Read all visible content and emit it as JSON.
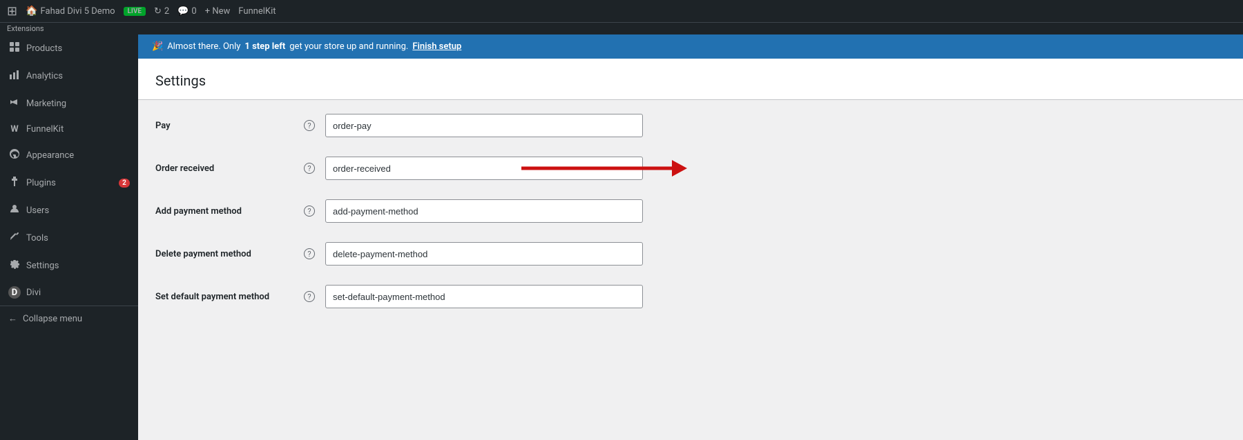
{
  "adminBar": {
    "wpIcon": "W",
    "siteName": "Fahad Divi 5 Demo",
    "liveBadge": "Live",
    "updates": "2",
    "comments": "0",
    "newLabel": "+ New",
    "funnelkit": "FunnelKit"
  },
  "extensionsBar": {
    "label": "Extensions"
  },
  "noticeBar": {
    "emoji": "🎉",
    "text1": "Almost there. Only",
    "boldText": "1 step left",
    "text2": "get your store up and running.",
    "linkText": "Finish setup"
  },
  "sidebar": {
    "items": [
      {
        "id": "products",
        "label": "Products",
        "icon": "📦",
        "badge": null
      },
      {
        "id": "analytics",
        "label": "Analytics",
        "icon": "📊",
        "badge": null
      },
      {
        "id": "marketing",
        "label": "Marketing",
        "icon": "📣",
        "badge": null
      },
      {
        "id": "funnelkit",
        "label": "FunnelKit",
        "icon": "W",
        "badge": null,
        "isSpecial": true
      },
      {
        "id": "appearance",
        "label": "Appearance",
        "icon": "🎨",
        "badge": null
      },
      {
        "id": "plugins",
        "label": "Plugins",
        "icon": "🔌",
        "badge": "2"
      },
      {
        "id": "users",
        "label": "Users",
        "icon": "👤",
        "badge": null
      },
      {
        "id": "tools",
        "label": "Tools",
        "icon": "🔧",
        "badge": null
      },
      {
        "id": "settings",
        "label": "Settings",
        "icon": "⚙",
        "badge": null
      },
      {
        "id": "divi",
        "label": "Divi",
        "icon": "D",
        "badge": null
      }
    ],
    "collapseLabel": "Collapse menu"
  },
  "settings": {
    "title": "Settings",
    "fields": [
      {
        "id": "pay",
        "label": "Pay",
        "value": "order-pay"
      },
      {
        "id": "order-received",
        "label": "Order received",
        "value": "order-received",
        "hasArrow": true
      },
      {
        "id": "add-payment-method",
        "label": "Add payment method",
        "value": "add-payment-method"
      },
      {
        "id": "delete-payment-method",
        "label": "Delete payment method",
        "value": "delete-payment-method"
      },
      {
        "id": "set-default-payment-method",
        "label": "Set default payment method",
        "value": "set-default-payment-method"
      }
    ]
  }
}
